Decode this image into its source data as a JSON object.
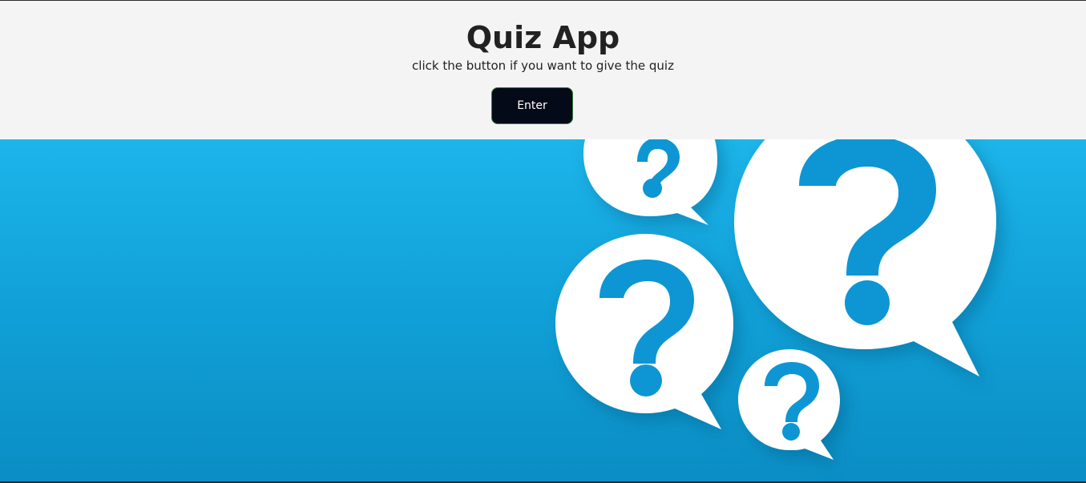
{
  "header": {
    "title": "Quiz App",
    "subtitle": "click the button if you want to give the quiz",
    "enter_label": "Enter"
  },
  "hero": {
    "image_description_icons": [
      "question-bubble-icon",
      "question-bubble-icon",
      "question-bubble-icon",
      "question-bubble-icon"
    ]
  },
  "colors": {
    "header_bg": "#f4f4f4",
    "button_bg": "#050a19",
    "button_border": "#2f7d32",
    "hero_blue": "#12a6dd",
    "question_mark_blue": "#0f96d3"
  }
}
